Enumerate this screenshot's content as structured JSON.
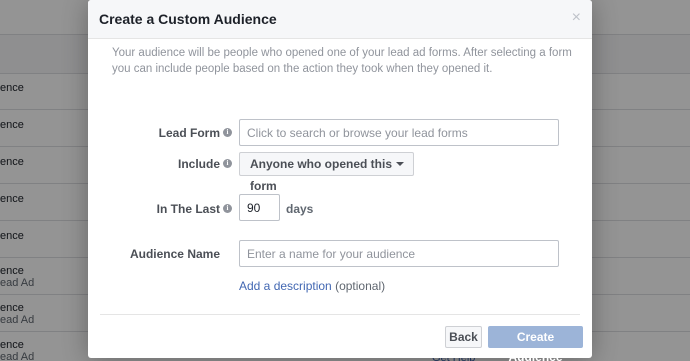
{
  "background": {
    "rows": [
      {
        "text": "ence",
        "sub": ""
      },
      {
        "text": "ence",
        "sub": ""
      },
      {
        "text": "ence",
        "sub": ""
      },
      {
        "text": "ence",
        "sub": ""
      },
      {
        "text": "ence",
        "sub": ""
      },
      {
        "text": "ence",
        "sub": "ead Ad"
      },
      {
        "text": "ence",
        "sub": "ead Ad"
      },
      {
        "text": "ence",
        "sub": "ead Ad"
      }
    ],
    "help_link": "Get Help"
  },
  "modal": {
    "title": "Create a Custom Audience",
    "close_glyph": "×",
    "intro": "Your audience will be people who opened one of your lead ad forms. After selecting a form you can include people based on the action they took when they opened it.",
    "lead_form": {
      "label": "Lead Form",
      "placeholder": "Click to search or browse your lead forms",
      "value": ""
    },
    "include": {
      "label": "Include",
      "selected": "Anyone who opened this form"
    },
    "in_the_last": {
      "label": "In The Last",
      "value": "90",
      "unit": "days"
    },
    "audience_name": {
      "label": "Audience Name",
      "placeholder": "Enter a name for your audience",
      "value": ""
    },
    "add_description": {
      "link": "Add a description",
      "optional": "(optional)"
    },
    "buttons": {
      "back": "Back",
      "create": "Create Audience"
    },
    "info_glyph": "i"
  },
  "colors": {
    "link": "#4267b2",
    "primary_disabled": "#9cb4d8",
    "overlay": "rgba(0,0,0,0.42)"
  }
}
